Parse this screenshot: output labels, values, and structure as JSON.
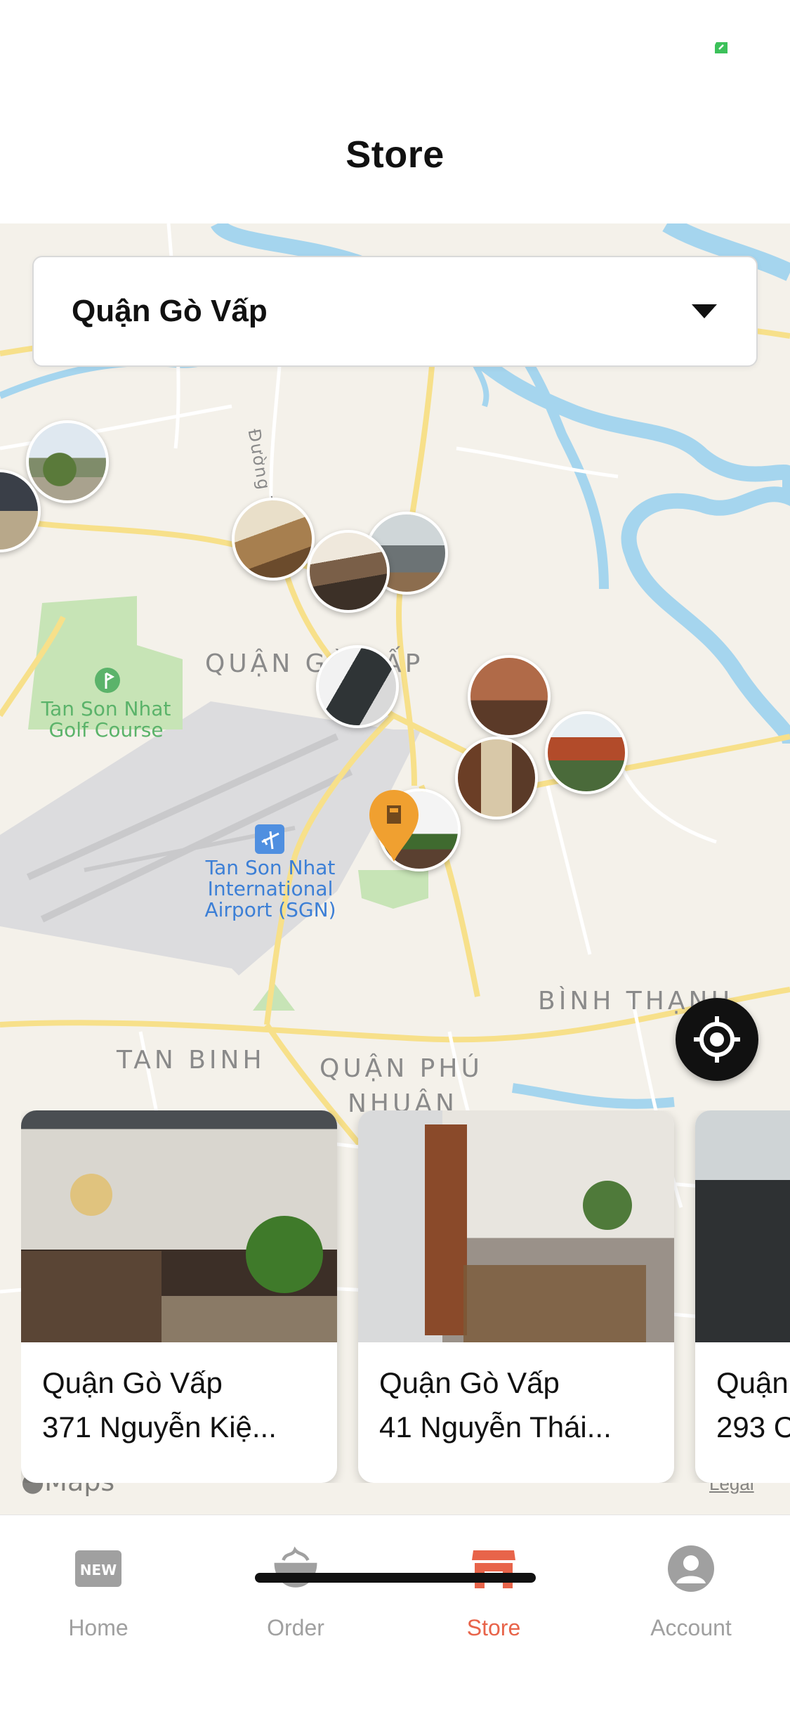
{
  "header": {
    "title": "Store"
  },
  "district_select": {
    "value": "Quận Gò Vấp"
  },
  "map": {
    "labels": {
      "go_vap": "QUẬN GÒ VẤP",
      "tan_binh": "TAN BINH",
      "phu_nhuan_1": "QUẬN PHÚ",
      "phu_nhuan_2": "NHUẬN",
      "binh_thanh": "BÌNH THẠNH",
      "golf_1": "Tan Son Nhat",
      "golf_2": "Golf Course",
      "airport_1": "Tan Son Nhat",
      "airport_2": "International",
      "airport_3": "Airport (SGN)",
      "street": "Đường T"
    },
    "attribution": "Maps",
    "legal": "Legal"
  },
  "cards": [
    {
      "district": "Quận Gò Vấp",
      "address": "371 Nguyễn Kiệ..."
    },
    {
      "district": "Quận Gò Vấp",
      "address": "41 Nguyễn Thái..."
    },
    {
      "district": "Quận",
      "address": "293 C"
    }
  ],
  "tabs": [
    {
      "label": "Home",
      "icon": "new-badge-icon"
    },
    {
      "label": "Order",
      "icon": "coffee-cup-icon"
    },
    {
      "label": "Store",
      "icon": "store-icon"
    },
    {
      "label": "Account",
      "icon": "user-icon"
    }
  ],
  "colors": {
    "accent": "#e8644a",
    "inactive": "#a0a0a0",
    "map_bg": "#f4f1ea",
    "water": "#a5d5ee",
    "road": "#f7e08a",
    "pin": "#f0a030",
    "status_battery": "#3cc15a"
  }
}
